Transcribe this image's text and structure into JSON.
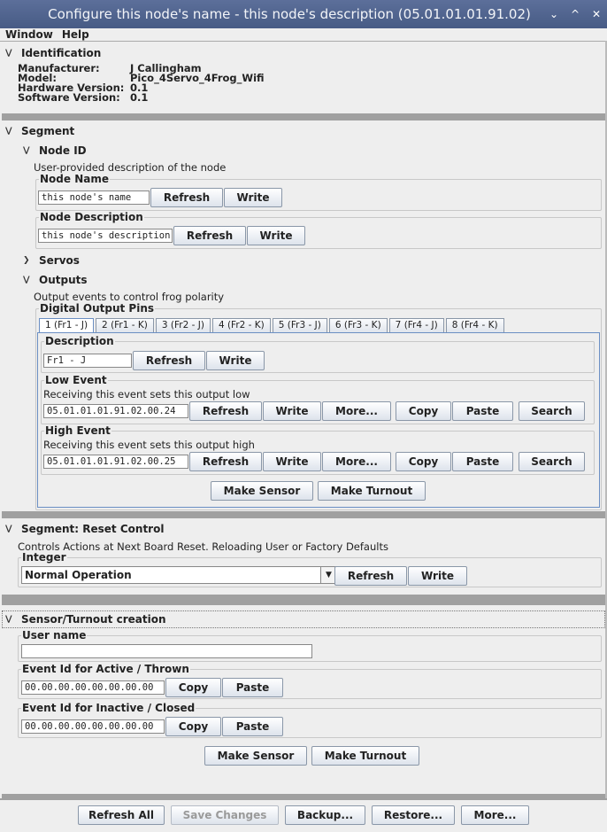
{
  "window": {
    "title": "Configure this node's name - this node's description (05.01.01.01.91.02)",
    "controls": [
      "⌄",
      "^",
      "✕"
    ]
  },
  "menu": [
    "Window",
    "Help"
  ],
  "identification": {
    "header": "Identification",
    "rows": [
      {
        "label": "Manufacturer:",
        "value": "J Callingham"
      },
      {
        "label": "Model:",
        "value": "Pico_4Servo_4Frog_Wifi"
      },
      {
        "label": "Hardware Version:",
        "value": "0.1"
      },
      {
        "label": "Software Version:",
        "value": "0.1"
      }
    ]
  },
  "segment": {
    "header": "Segment",
    "node_id": {
      "header": "Node ID",
      "description": "User-provided description of the node",
      "name": {
        "legend": "Node Name",
        "value": "this node's name",
        "refresh": "Refresh",
        "write": "Write"
      },
      "desc": {
        "legend": "Node Description",
        "value": "this node's description",
        "refresh": "Refresh",
        "write": "Write"
      }
    },
    "servos": {
      "header": "Servos"
    },
    "outputs": {
      "header": "Outputs",
      "description": "Output events to control frog polarity",
      "pins_legend": "Digital Output Pins",
      "tabs": [
        "1 (Fr1 - J)",
        "2 (Fr1 - K)",
        "3 (Fr2 - J)",
        "4 (Fr2 - K)",
        "5 (Fr3 - J)",
        "6 (Fr3 - K)",
        "7 (Fr4 - J)",
        "8 (Fr4 - K)"
      ],
      "desc": {
        "legend": "Description",
        "value": "Fr1 - J",
        "refresh": "Refresh",
        "write": "Write"
      },
      "low": {
        "legend": "Low Event",
        "text": "Receiving this event sets this output low",
        "value": "05.01.01.01.91.02.00.24",
        "buttons": [
          "Refresh",
          "Write",
          "More...",
          "Copy",
          "Paste",
          "Search"
        ]
      },
      "high": {
        "legend": "High Event",
        "text": "Receiving this event sets this output high",
        "value": "05.01.01.01.91.02.00.25",
        "buttons": [
          "Refresh",
          "Write",
          "More...",
          "Copy",
          "Paste",
          "Search"
        ]
      },
      "make_sensor": "Make Sensor",
      "make_turnout": "Make Turnout"
    }
  },
  "reset": {
    "header": "Segment: Reset Control",
    "description": "Controls Actions at Next Board Reset. Reloading User or Factory Defaults",
    "legend": "Integer",
    "selected": "Normal Operation",
    "refresh": "Refresh",
    "write": "Write"
  },
  "sensor_turnout": {
    "header": "Sensor/Turnout creation",
    "username_legend": "User name",
    "username_value": "",
    "active_legend": "Event Id for Active / Thrown",
    "active_value": "00.00.00.00.00.00.00.00",
    "inactive_legend": "Event Id for Inactive / Closed",
    "inactive_value": "00.00.00.00.00.00.00.00",
    "copy": "Copy",
    "paste": "Paste",
    "make_sensor": "Make Sensor",
    "make_turnout": "Make Turnout"
  },
  "bottom": {
    "refresh_all": "Refresh All",
    "save_changes": "Save Changes",
    "backup": "Backup...",
    "restore": "Restore...",
    "more": "More..."
  }
}
